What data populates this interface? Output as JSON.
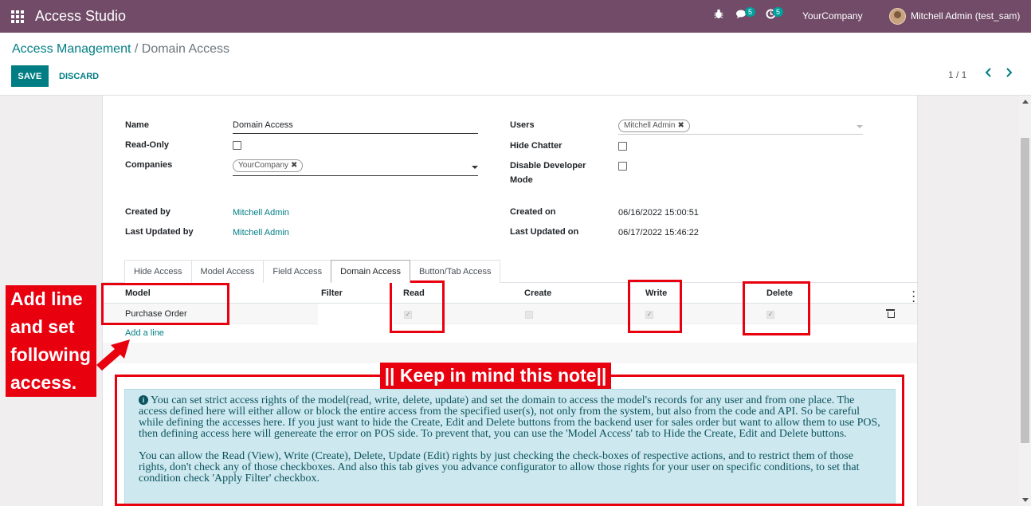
{
  "app": {
    "title": "Access Studio"
  },
  "navbar": {
    "messages_count": "5",
    "activities_count": "5",
    "company": "YourCompany",
    "user": "Mitchell Admin (test_sam)"
  },
  "breadcrumb": {
    "parent": "Access Management",
    "separator": "/",
    "current": "Domain Access"
  },
  "toolbar": {
    "save_label": "SAVE",
    "discard_label": "DISCARD"
  },
  "pager": {
    "value": "1 / 1"
  },
  "form": {
    "name_label": "Name",
    "name_value": "Domain Access",
    "readonly_label": "Read-Only",
    "readonly_checked": false,
    "companies_label": "Companies",
    "companies_tag": "YourCompany",
    "users_label": "Users",
    "users_tag": "Mitchell Admin",
    "hide_chatter_label": "Hide Chatter",
    "hide_chatter_checked": false,
    "disable_dev_label_1": "Disable Developer",
    "disable_dev_label_2": "Mode",
    "disable_dev_checked": false,
    "created_by_label": "Created by",
    "created_by_value": "Mitchell Admin",
    "last_updated_by_label": "Last Updated by",
    "last_updated_by_value": "Mitchell Admin",
    "created_on_label": "Created on",
    "created_on_value": "06/16/2022 15:00:51",
    "last_updated_on_label": "Last Updated on",
    "last_updated_on_value": "06/17/2022 15:46:22"
  },
  "tabs": [
    {
      "label": "Hide Access",
      "active": false
    },
    {
      "label": "Model Access",
      "active": false
    },
    {
      "label": "Field Access",
      "active": false
    },
    {
      "label": "Domain Access",
      "active": true
    },
    {
      "label": "Button/Tab Access",
      "active": false
    }
  ],
  "table": {
    "headers": {
      "model": "Model",
      "filter": "Filter",
      "read": "Read",
      "create": "Create",
      "write": "Write",
      "delete": "Delete"
    },
    "rows": [
      {
        "model": "Purchase Order",
        "read": true,
        "create": false,
        "write": true,
        "delete": true
      }
    ],
    "add_line": "Add a line"
  },
  "note": {
    "paragraph_1": "You can set strict access rights of the model(read, write, delete, update) and set the domain to access the model's records for any user and from one place. The access defined here will either allow or block the entire access from the specified user(s), not only from the system, but also from the code and API. So be careful while defining the accesses here. If you just want to hide the Create, Edit and Delete buttons from the backend user for sales order but want to allow them to use POS, then defining access here will genereate the error on POS side. To prevent that, you can use the 'Model Access' tab to Hide the Create, Edit and Delete buttons.",
    "paragraph_2": "You can allow the Read (View), Write (Create), Delete, Update (Edit) rights by just checking the check-boxes of respective actions, and to restrict them of those rights, don't check any of those checkboxes. And also this tab gives you advance configurator to allow those rights for your user on specific conditions, to set that condition check 'Apply Filter' checkbox."
  },
  "annotations": {
    "left_callout": [
      "Add line",
      "and set",
      "following",
      "access."
    ],
    "note_callout": "|| Keep in mind this note||",
    "highlight_color": "#e8000f"
  },
  "colors": {
    "navbar": "#714b67",
    "accent": "#017e84",
    "note_bg": "#cde8ee"
  }
}
